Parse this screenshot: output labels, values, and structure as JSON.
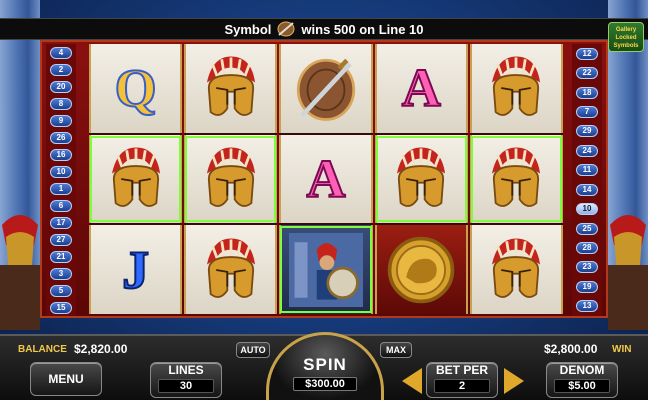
{
  "message": {
    "prefix": "Symbol",
    "suffix": "wins 500 on Line 10"
  },
  "corner_logo": {
    "lines": [
      "Gallery",
      "Locked",
      "Symbols"
    ]
  },
  "left_lines": [
    "4",
    "2",
    "20",
    "8",
    "9",
    "26",
    "16",
    "10",
    "1",
    "6",
    "17",
    "27",
    "21",
    "3",
    "5",
    "15"
  ],
  "right_lines": [
    "12",
    "22",
    "18",
    "7",
    "29",
    "24",
    "11",
    "14",
    "10",
    "25",
    "28",
    "23",
    "19",
    "13"
  ],
  "left_highlight": [],
  "right_highlight": [
    "10"
  ],
  "reels": [
    [
      "Q",
      "helmet",
      "J"
    ],
    [
      "helmet",
      "helmet",
      "helmet"
    ],
    [
      "shield",
      "A",
      "warrior"
    ],
    [
      "A",
      "helmet",
      "coin"
    ],
    [
      "helmet",
      "helmet",
      "helmet"
    ]
  ],
  "winning_cells": [
    "0-1",
    "1-1",
    "2-2",
    "3-1",
    "4-1"
  ],
  "bottom": {
    "balance_label": "BALANCE",
    "balance_value": "$2,820.00",
    "win_label": "WIN",
    "win_value": "$2,800.00",
    "menu_label": "MENU",
    "lines_label": "LINES",
    "lines_value": "30",
    "auto_label": "AUTO",
    "max_label": "MAX",
    "spin_label": "SPIN",
    "spin_value": "$300.00",
    "betper_label": "BET PER",
    "betper_value": "2",
    "denom_label": "DENOM",
    "denom_value": "$5.00"
  },
  "colors": {
    "accent_gold": "#f2c84a",
    "win_outline": "#7cff3a",
    "frame_red": "#8a1010"
  }
}
